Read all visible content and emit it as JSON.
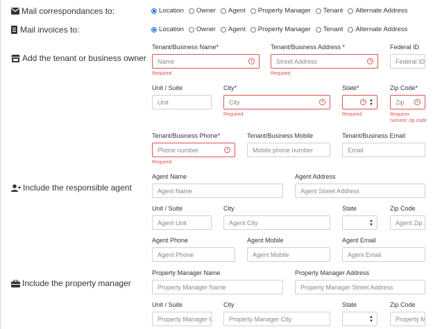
{
  "sections": {
    "mail_corr": "Mail correspondances to:",
    "mail_invoices": "Mail invoices to:",
    "add_tenant": "Add the tenant or business owner",
    "include_agent": "Include the responsible agent",
    "include_pm": "Include the property manager"
  },
  "radio_options": [
    "Location",
    "Owner",
    "Agent",
    "Property Manager",
    "Tenant",
    "Alternate Address"
  ],
  "mail_corr_selected": "Location",
  "mail_invoices_selected": "Location",
  "tenant": {
    "name_label": "Tenant/Business Name*",
    "name_placeholder": "Name",
    "address_label": "Tenant/Business Address *",
    "address_placeholder": "Street Address",
    "federal_label": "Federal ID",
    "federal_placeholder": "Federal ID",
    "unit_label": "Unit / Suite",
    "unit_placeholder": "Unit",
    "city_label": "City*",
    "city_placeholder": "City",
    "state_label": "State*",
    "zip_label": "Zip Code*",
    "zip_placeholder": "Zip",
    "phone_label": "Tenant/Business Phone*",
    "phone_placeholder": "Phone number",
    "mobile_label": "Tenant/Business Mobile",
    "mobile_placeholder": "Mobile phone number",
    "email_label": "Tenant/Business Email",
    "email_placeholder": "Email",
    "required": "Required",
    "zip_error_1": "Requires",
    "zip_error_2": "numeric zip code"
  },
  "agent": {
    "name_label": "Agent Name",
    "name_placeholder": "Agent Name",
    "address_label": "Agent Address",
    "address_placeholder": "Agent Street Address",
    "unit_label": "Unit / Suite",
    "unit_placeholder": "Agent Unit",
    "city_label": "City",
    "city_placeholder": "Agent City",
    "state_label": "State",
    "zip_label": "Zip Code",
    "zip_placeholder": "Agent Zip",
    "phone_label": "Agent Phone",
    "phone_placeholder": "Agent Phone",
    "mobile_label": "Agent Mobile",
    "mobile_placeholder": "Agent Mobile",
    "email_label": "Agent Email",
    "email_placeholder": "Agent Email"
  },
  "pm": {
    "name_label": "Property Manager Name",
    "name_placeholder": "Property Manager Name",
    "address_label": "Property Manager Address",
    "address_placeholder": "Property Manager Street Address",
    "unit_label": "Unit / Suite",
    "unit_placeholder": "Property Manager Unit",
    "city_label": "City",
    "city_placeholder": "Property Manager City",
    "state_label": "State",
    "zip_label": "Zip Code",
    "zip_placeholder": "Property Manager Zip"
  },
  "colors": {
    "error": "#d9534f",
    "accent": "#1e6fd9"
  }
}
